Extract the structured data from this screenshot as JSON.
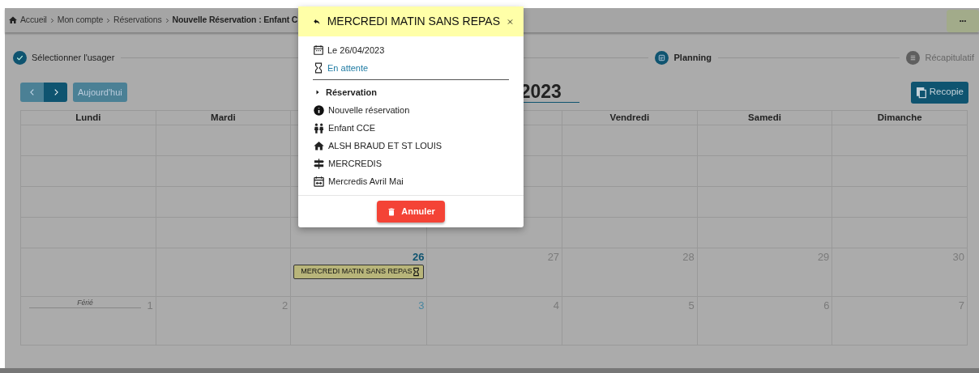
{
  "breadcrumb": [
    {
      "label": "Accueil",
      "current": false
    },
    {
      "label": "Mon compte",
      "current": false
    },
    {
      "label": "Réservations",
      "current": false
    },
    {
      "label": "Nouvelle Réservation : Enfant C",
      "current": true
    }
  ],
  "menu_button": {
    "label": "•••"
  },
  "stepper": [
    {
      "label": "Sélectionner l'usager",
      "completed": true,
      "active": false
    },
    {
      "label": "Planning",
      "completed": false,
      "active": true
    },
    {
      "label": "Récapitulatif",
      "completed": false,
      "active": false
    }
  ],
  "toolbar": {
    "today_button": "Aujourd'hui",
    "title": "2023",
    "copy_button": "Recopie"
  },
  "calendar": {
    "weekdays": {
      "column_1": "Lundi",
      "column_2": "Mardi",
      "column_5": "Vendredi",
      "column_6": "Samedi",
      "column_7": "Dimanche"
    },
    "weeks": [
      {
        "days": {
          "column_3": {
            "number": "26",
            "today": true,
            "highlighted": false,
            "events": [
              {
                "label": "MERCREDI MATIN SANS REPAS",
                "pending": true
              }
            ]
          },
          "column_4": {
            "number": "27",
            "today": false,
            "highlighted": false
          },
          "column_5": {
            "number": "28",
            "today": false,
            "highlighted": false
          },
          "column_6": {
            "number": "29",
            "today": false,
            "highlighted": false
          },
          "column_7": {
            "number": "30",
            "today": false,
            "highlighted": false
          }
        }
      },
      {
        "days": {
          "column_1": {
            "number": "1",
            "today": false,
            "highlighted": false,
            "holiday": "Férié"
          },
          "column_2": {
            "number": "2",
            "today": false,
            "highlighted": false
          },
          "column_3": {
            "number": "3",
            "today": false,
            "highlighted": true
          },
          "column_4": {
            "number": "4",
            "today": false,
            "highlighted": false
          },
          "column_5": {
            "number": "5",
            "today": false,
            "highlighted": false
          },
          "column_6": {
            "number": "6",
            "today": false,
            "highlighted": false
          },
          "column_7": {
            "number": "7",
            "today": false,
            "highlighted": false
          }
        }
      }
    ]
  },
  "popup": {
    "title": "MERCREDI MATIN SANS REPAS",
    "date": "Le 26/04/2023",
    "status": "En attente",
    "section": {
      "label": "Réservation",
      "expanded": false
    },
    "details": [
      {
        "kind": "info",
        "text": "Nouvelle réservation"
      },
      {
        "kind": "children",
        "text": "Enfant CCE"
      },
      {
        "kind": "house",
        "text": "ALSH BRAUD ET ST LOUIS"
      },
      {
        "kind": "signpost",
        "text": "MERCREDIS"
      },
      {
        "kind": "period",
        "text": "Mercredis Avril Mai"
      }
    ],
    "cancel_button": "Annuler"
  }
}
